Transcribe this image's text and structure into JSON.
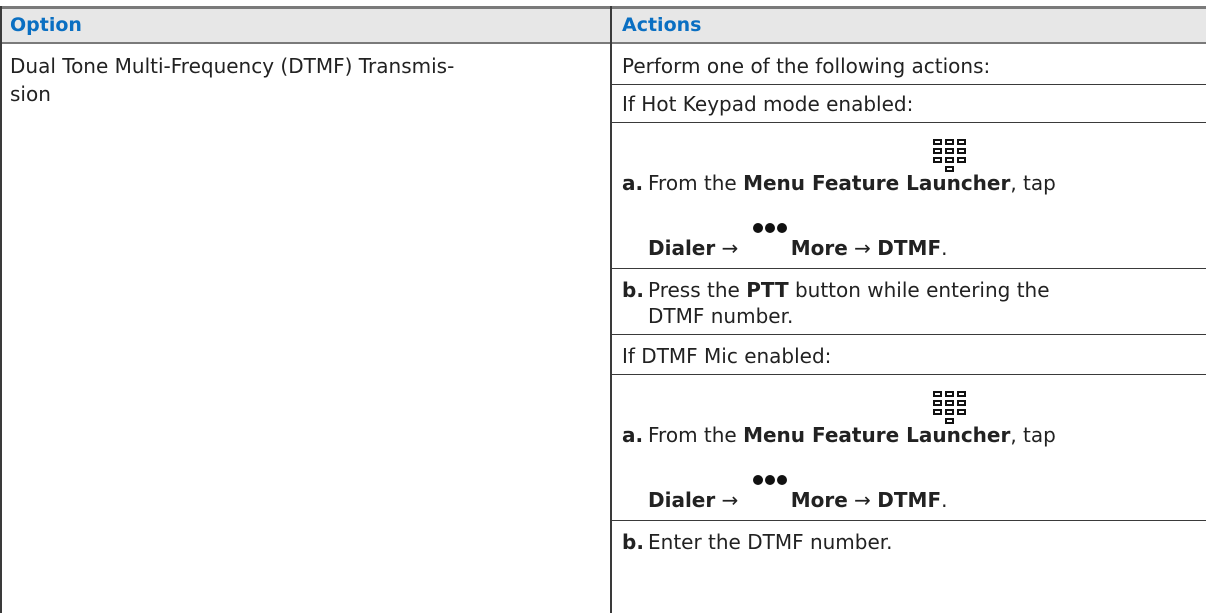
{
  "table": {
    "headers": {
      "option": "Option",
      "actions": "Actions"
    },
    "row": {
      "option_line1": "Dual Tone Multi-Frequency (DTMF) Transmis-",
      "option_line2": "sion",
      "intro": "Perform one of the following actions:",
      "section1": {
        "heading": "If Hot Keypad mode enabled:",
        "step_a": {
          "letter": "a.",
          "text1": "From the ",
          "bold1": "Menu Feature Launcher",
          "text2": ", tap",
          "line2_bold1": "Dialer",
          "arrow1": " → ",
          "line2_bold2": "More",
          "arrow2": " → ",
          "line2_bold3": "DTMF",
          "period": "."
        },
        "step_b": {
          "letter": "b.",
          "text1": "Press the ",
          "bold1": "PTT",
          "text2": " button while entering the",
          "line2": "DTMF number."
        }
      },
      "section2": {
        "heading": "If DTMF Mic enabled:",
        "step_a": {
          "letter": "a.",
          "text1": "From the ",
          "bold1": "Menu Feature Launcher",
          "text2": ", tap",
          "line2_bold1": "Dialer",
          "arrow1": " → ",
          "line2_bold2": "More",
          "arrow2": " → ",
          "line2_bold3": "DTMF",
          "period": "."
        },
        "step_b": {
          "letter": "b.",
          "text": "Enter the DTMF number."
        }
      }
    }
  },
  "icons": {
    "keypad": "keypad-icon",
    "more": "more-dots-icon"
  },
  "colors": {
    "header_text": "#0a6fc2",
    "header_bg": "#e7e7e7",
    "rule": "#3a3a3a"
  }
}
